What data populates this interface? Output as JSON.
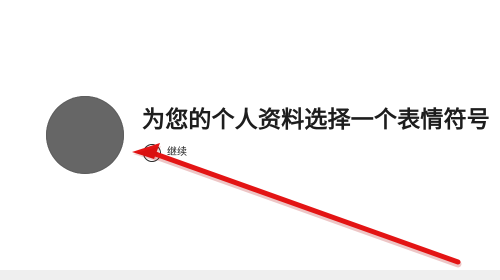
{
  "screen": {
    "title": "为您的个人资料选择一个表情符号",
    "continue_key": "A",
    "continue_label": "继续"
  },
  "annotation": {
    "icon": "red-arrow-icon",
    "color": "#e31414"
  },
  "icons": {
    "avatar": "avatar-circle",
    "continue": "button-a-icon"
  },
  "colors": {
    "background": "#ffffff",
    "avatar": "#666666",
    "text": "#1d1d1d",
    "arrow": "#e31414"
  }
}
